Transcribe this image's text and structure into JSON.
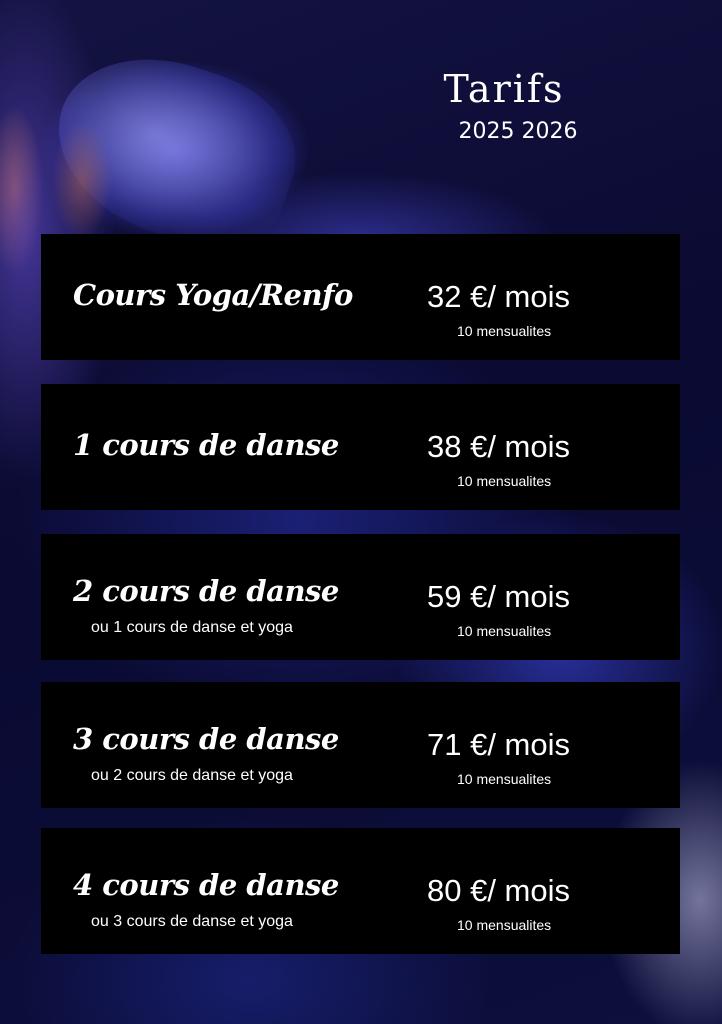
{
  "header": {
    "title": "Tarifs",
    "years": "2025 2026"
  },
  "tariffs": [
    {
      "name": "Cours Yoga/Renfo",
      "subtitle": "",
      "price": "32 €/ mois",
      "installments": "10 mensualites"
    },
    {
      "name": "1 cours de danse",
      "subtitle": "",
      "price": "38 €/ mois",
      "installments": "10 mensualites"
    },
    {
      "name": "2 cours de danse",
      "subtitle": "ou 1 cours de danse et yoga",
      "price": "59 €/ mois",
      "installments": "10 mensualites"
    },
    {
      "name": "3 cours de danse",
      "subtitle": "ou 2 cours de danse et yoga",
      "price": "71 €/ mois",
      "installments": "10 mensualites"
    },
    {
      "name": "4 cours de danse",
      "subtitle": "ou 3 cours de danse et yoga",
      "price": "80 €/ mois",
      "installments": "10 mensualites"
    }
  ],
  "colors": {
    "background": "#0b0a2c",
    "card": "#000000",
    "text": "#ffffff"
  }
}
